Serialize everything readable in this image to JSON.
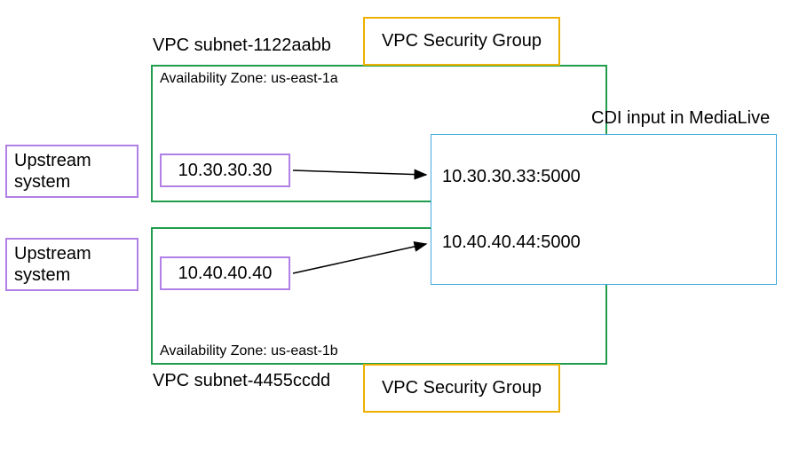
{
  "subnet_top_title": "VPC subnet-1122aabb",
  "subnet_bottom_title": "VPC subnet-4455ccdd",
  "az_top": "Availability Zone: us-east-1a",
  "az_bottom": "Availability Zone: us-east-1b",
  "security_group_label": "VPC Security Group",
  "upstream_system_label": "Upstream\nsystem",
  "source_ip_top": "10.30.30.30",
  "source_ip_bottom": "10.40.40.40",
  "cdi_title": "CDI input in MediaLive",
  "endpoint_top": "10.30.30.33:5000",
  "endpoint_bottom": "10.40.40.44:5000"
}
